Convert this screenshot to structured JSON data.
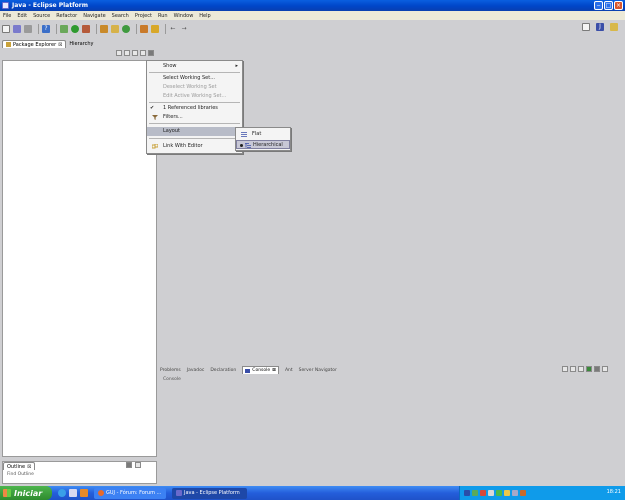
{
  "window": {
    "title": "Java - Eclipse Platform"
  },
  "menubar": [
    "File",
    "Edit",
    "Source",
    "Refactor",
    "Navigate",
    "Search",
    "Project",
    "Run",
    "Window",
    "Help"
  ],
  "explorer": {
    "tabs": [
      {
        "label": "Package Explorer",
        "close": "⊠",
        "active": true
      },
      {
        "label": "Hierarchy",
        "close": "",
        "active": false
      }
    ]
  },
  "context_menu": {
    "items": [
      {
        "label": "Show",
        "arrow": "▸",
        "disabled": false
      },
      {
        "label": "Select Working Set...",
        "disabled": false
      },
      {
        "label": "Deselect Working Set",
        "disabled": true
      },
      {
        "label": "Edit Active Working Set...",
        "disabled": true
      },
      {
        "label": "1 Referenced libraries",
        "check": "✔",
        "disabled": false
      },
      {
        "label": "Filters...",
        "disabled": false
      },
      {
        "label": "Layout",
        "arrow": "▸",
        "highlighted": true
      },
      {
        "label": "Link With Editor",
        "disabled": false
      }
    ]
  },
  "layout_submenu": {
    "items": [
      {
        "label": "Flat",
        "selected": false
      },
      {
        "label": "Hierarchical",
        "selected": true
      }
    ]
  },
  "outline": {
    "tab_label": "Outline",
    "close": "⊠",
    "body_text": "Find Outline"
  },
  "bottom_panel": {
    "tabs": [
      {
        "label": "Problems",
        "active": false
      },
      {
        "label": "Javadoc",
        "active": false
      },
      {
        "label": "Declaration",
        "active": false
      },
      {
        "label": "Console",
        "active": true,
        "close": "⊠"
      },
      {
        "label": "Ant",
        "active": false
      },
      {
        "label": "Server Navigator",
        "active": false
      }
    ],
    "body_text": "Console"
  },
  "taskbar": {
    "start_label": "Iniciar",
    "tasks": [
      {
        "label": "GUJ - Fórum: Forum ...",
        "active": false
      },
      {
        "label": "Java - Eclipse Platform",
        "active": true
      }
    ],
    "clock": "18:21"
  },
  "colors": {
    "titlebar": "#0a5fe0",
    "menu_highlight": "#b8bcc8",
    "taskbar": "#245edb",
    "start_button": "#2e8b2e"
  }
}
